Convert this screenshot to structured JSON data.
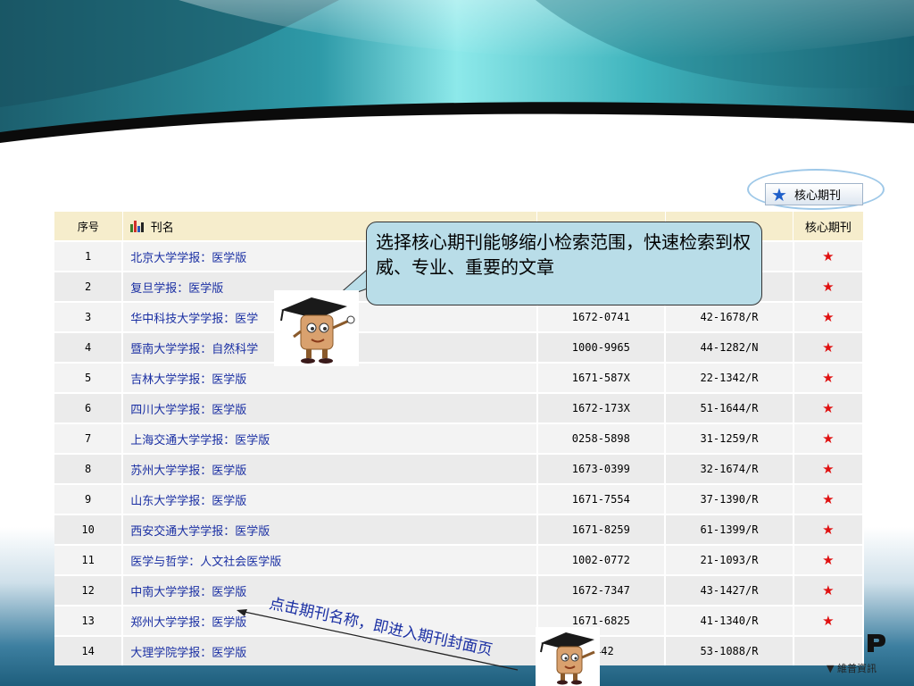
{
  "toolbar": {
    "core_button_label": "核心期刊",
    "core_button_icon": "star-icon"
  },
  "table": {
    "headers": {
      "no": "序号",
      "name": "刊名",
      "core": "核心期刊"
    },
    "rows": [
      {
        "no": "1",
        "name": "北京大学学报：医学版",
        "issn": "",
        "cn": "",
        "core": "★"
      },
      {
        "no": "2",
        "name": "复旦学报：医学版",
        "issn": "",
        "cn": "",
        "core": "★"
      },
      {
        "no": "3",
        "name": "华中科技大学学报：医学",
        "issn": "1672-0741",
        "cn": "42-1678/R",
        "core": "★"
      },
      {
        "no": "4",
        "name": "暨南大学学报：自然科学",
        "issn": "1000-9965",
        "cn": "44-1282/N",
        "core": "★"
      },
      {
        "no": "5",
        "name": "吉林大学学报：医学版",
        "issn": "1671-587X",
        "cn": "22-1342/R",
        "core": "★"
      },
      {
        "no": "6",
        "name": "四川大学学报：医学版",
        "issn": "1672-173X",
        "cn": "51-1644/R",
        "core": "★"
      },
      {
        "no": "7",
        "name": "上海交通大学学报：医学版",
        "issn": "0258-5898",
        "cn": "31-1259/R",
        "core": "★"
      },
      {
        "no": "8",
        "name": "苏州大学学报：医学版",
        "issn": "1673-0399",
        "cn": "32-1674/R",
        "core": "★"
      },
      {
        "no": "9",
        "name": "山东大学学报：医学版",
        "issn": "1671-7554",
        "cn": "37-1390/R",
        "core": "★"
      },
      {
        "no": "10",
        "name": "西安交通大学学报：医学版",
        "issn": "1671-8259",
        "cn": "61-1399/R",
        "core": "★"
      },
      {
        "no": "11",
        "name": "医学与哲学：人文社会医学版",
        "issn": "1002-0772",
        "cn": "21-1093/R",
        "core": "★"
      },
      {
        "no": "12",
        "name": "中南大学学报：医学版",
        "issn": "1672-7347",
        "cn": "43-1427/R",
        "core": "★"
      },
      {
        "no": "13",
        "name": "郑州大学学报：医学版",
        "issn": "1671-6825",
        "cn": "41-1340/R",
        "core": "★"
      },
      {
        "no": "14",
        "name": "大理学院学报：医学版",
        "issn": "4442",
        "cn": "53-1088/R",
        "core": ""
      }
    ]
  },
  "callout": {
    "text": "选择核心期刊能够缩小检索范围，快速检索到权威、专业、重要的文章"
  },
  "annotation": {
    "text": "点击期刊名称，即进入期刊封面页"
  },
  "logo": {
    "text": "▼ 維普資訊"
  },
  "colors": {
    "header_teal": "#1f6f80",
    "table_header": "#f6edcc",
    "link_blue": "#1a2fa3",
    "star_red": "#e01010",
    "callout_fill": "#b9dde8"
  }
}
